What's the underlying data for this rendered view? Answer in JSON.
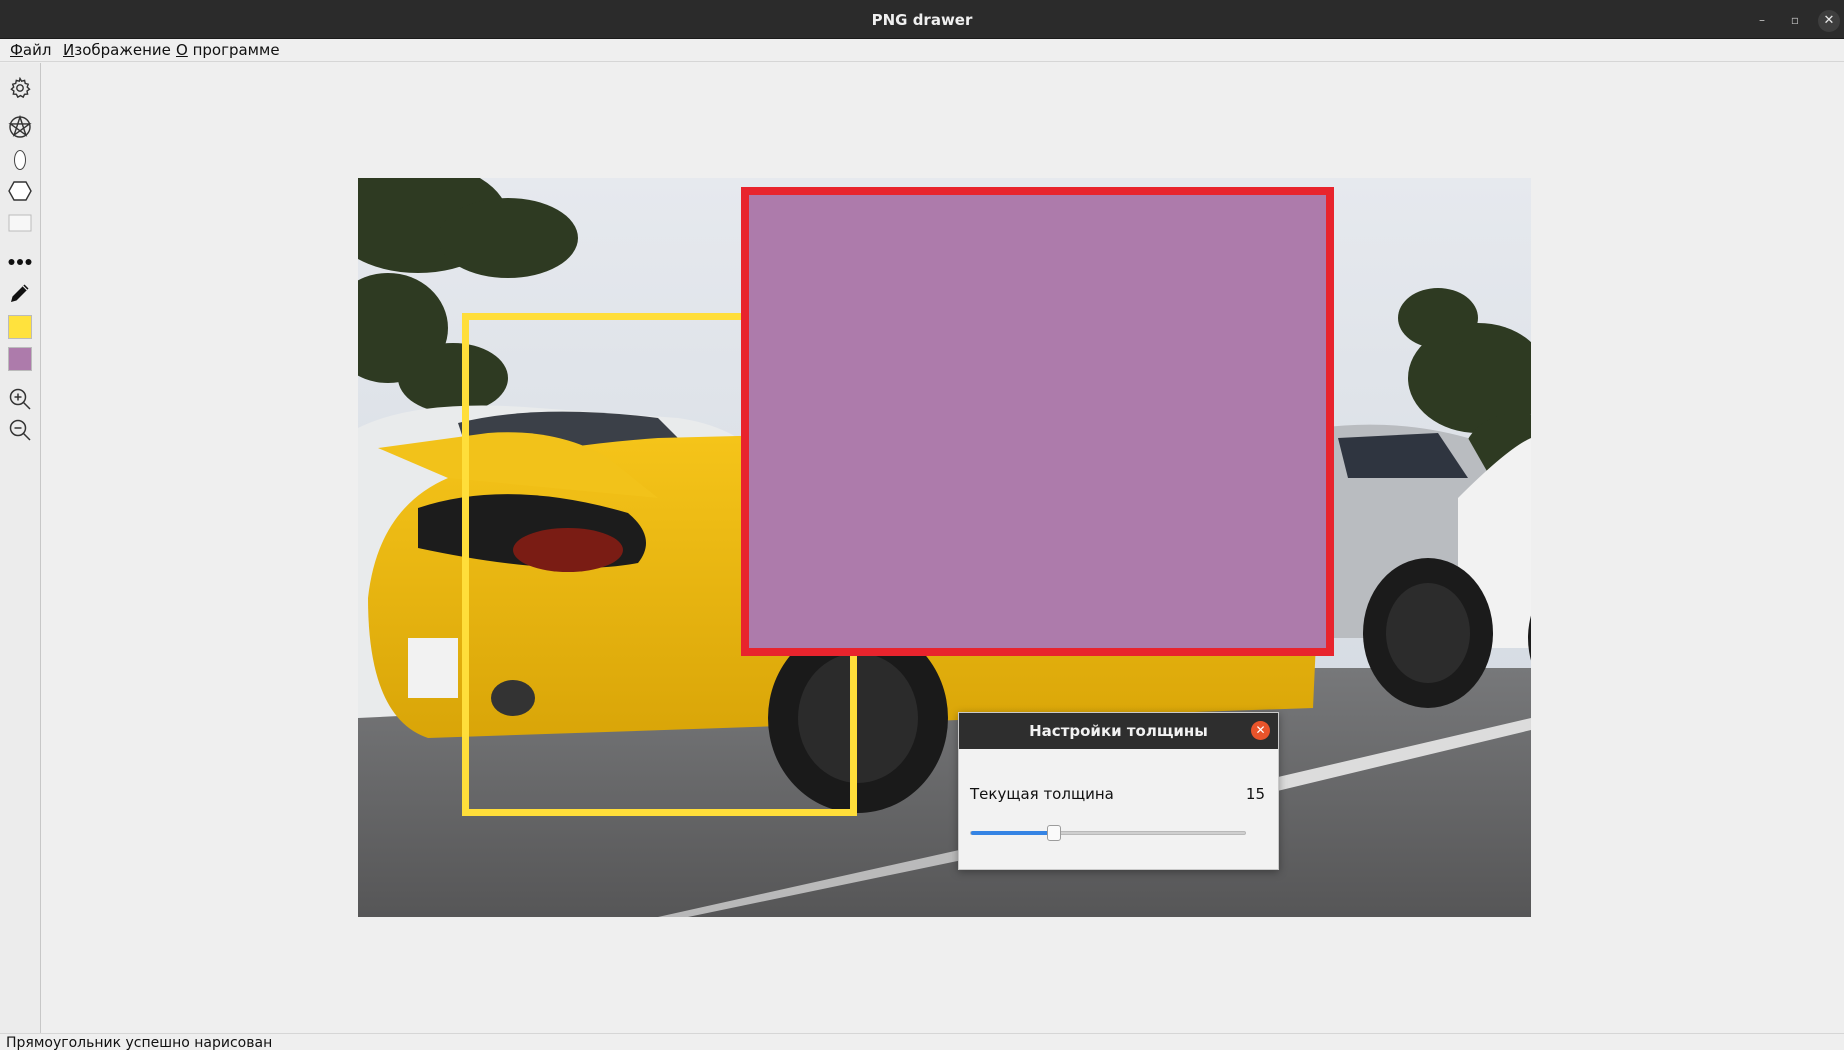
{
  "window": {
    "title": "PNG drawer",
    "min_glyph": "–",
    "max_glyph": "▫",
    "close_glyph": "✕"
  },
  "menu": {
    "items": [
      "Файл",
      "Изображение",
      "О программе"
    ]
  },
  "toolbar": {
    "tools": [
      "settings-icon",
      "pentagram-icon",
      "ellipse-icon",
      "hexagon-icon",
      "rectangle-icon",
      "more-icon",
      "pencil-icon",
      "fill-color-swatch",
      "stroke-color-swatch",
      "zoom-in-icon",
      "zoom-out-icon"
    ],
    "fill_color": "#ffe23d",
    "stroke_color": "#ad7bab"
  },
  "canvas": {
    "shapes": [
      {
        "type": "rectangle",
        "outline_color": "#ffde3a",
        "fill": "none"
      },
      {
        "type": "rectangle",
        "outline_color": "#e8242d",
        "fill": "#ad7bab"
      }
    ]
  },
  "thickness_dialog": {
    "title": "Настройки толщины",
    "label": "Текущая толщина",
    "value": "15",
    "slider_fraction": 0.3,
    "close_glyph": "✕"
  },
  "status": {
    "message": "Прямоугольник успешно нарисован"
  }
}
